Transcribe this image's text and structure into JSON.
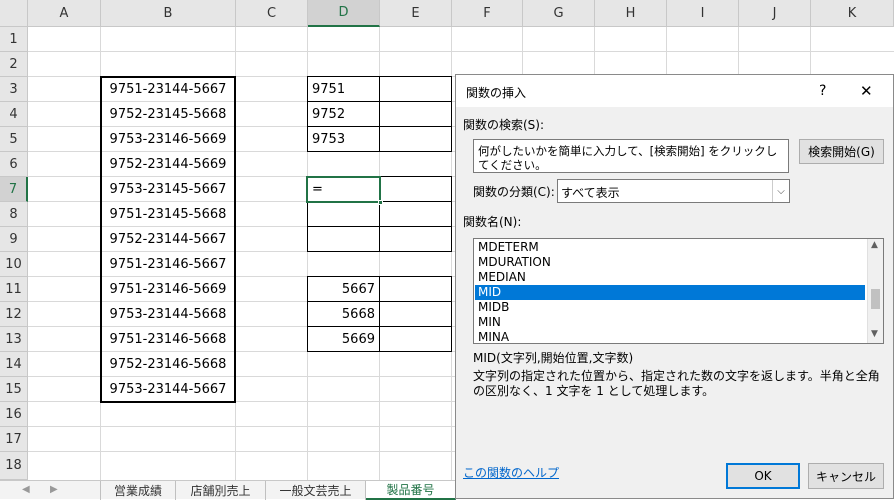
{
  "columns": [
    "A",
    "B",
    "C",
    "D",
    "E",
    "F",
    "G",
    "H",
    "I",
    "J",
    "K"
  ],
  "rows": [
    "1",
    "2",
    "3",
    "4",
    "5",
    "6",
    "7",
    "8",
    "9",
    "10",
    "11",
    "12",
    "13",
    "14",
    "15",
    "16",
    "17",
    "18"
  ],
  "column_b_values": [
    "9751-23144-5667",
    "9752-23145-5668",
    "9753-23146-5669",
    "9752-23144-5669",
    "9753-23145-5667",
    "9751-23145-5668",
    "9752-23144-5667",
    "9751-23146-5667",
    "9751-23146-5669",
    "9753-23144-5668",
    "9751-23146-5668",
    "9752-23146-5668",
    "9753-23144-5667"
  ],
  "column_d_top": [
    "9751",
    "9752",
    "9753"
  ],
  "active_cell_value": "=",
  "column_d_bottom": [
    "5667",
    "5668",
    "5669"
  ],
  "sheet_tabs": [
    "営業成績",
    "店舗別売上",
    "一般文芸売上",
    "製品番号"
  ],
  "dialog": {
    "title": "関数の挿入",
    "help_glyph": "?",
    "close_glyph": "✕",
    "search_label": "関数の検索(S):",
    "search_text": "何がしたいかを簡単に入力して、[検索開始] をクリックしてください。",
    "search_button": "検索開始(G)",
    "category_label": "関数の分類(C):",
    "category_value": "すべて表示",
    "function_list_label": "関数名(N):",
    "functions": [
      "MDETERM",
      "MDURATION",
      "MEDIAN",
      "MID",
      "MIDB",
      "MIN",
      "MINA"
    ],
    "selected_function": "MID",
    "syntax": "MID(文字列,開始位置,文字数)",
    "description": "文字列の指定された位置から、指定された数の文字を返します。半角と全角の区別なく、1 文字を 1 として処理します。",
    "help_link": "この関数のヘルプ",
    "ok_button": "OK",
    "cancel_button": "キャンセル"
  },
  "colors": {
    "accent_green": "#217346",
    "selection_blue": "#0078d7"
  }
}
